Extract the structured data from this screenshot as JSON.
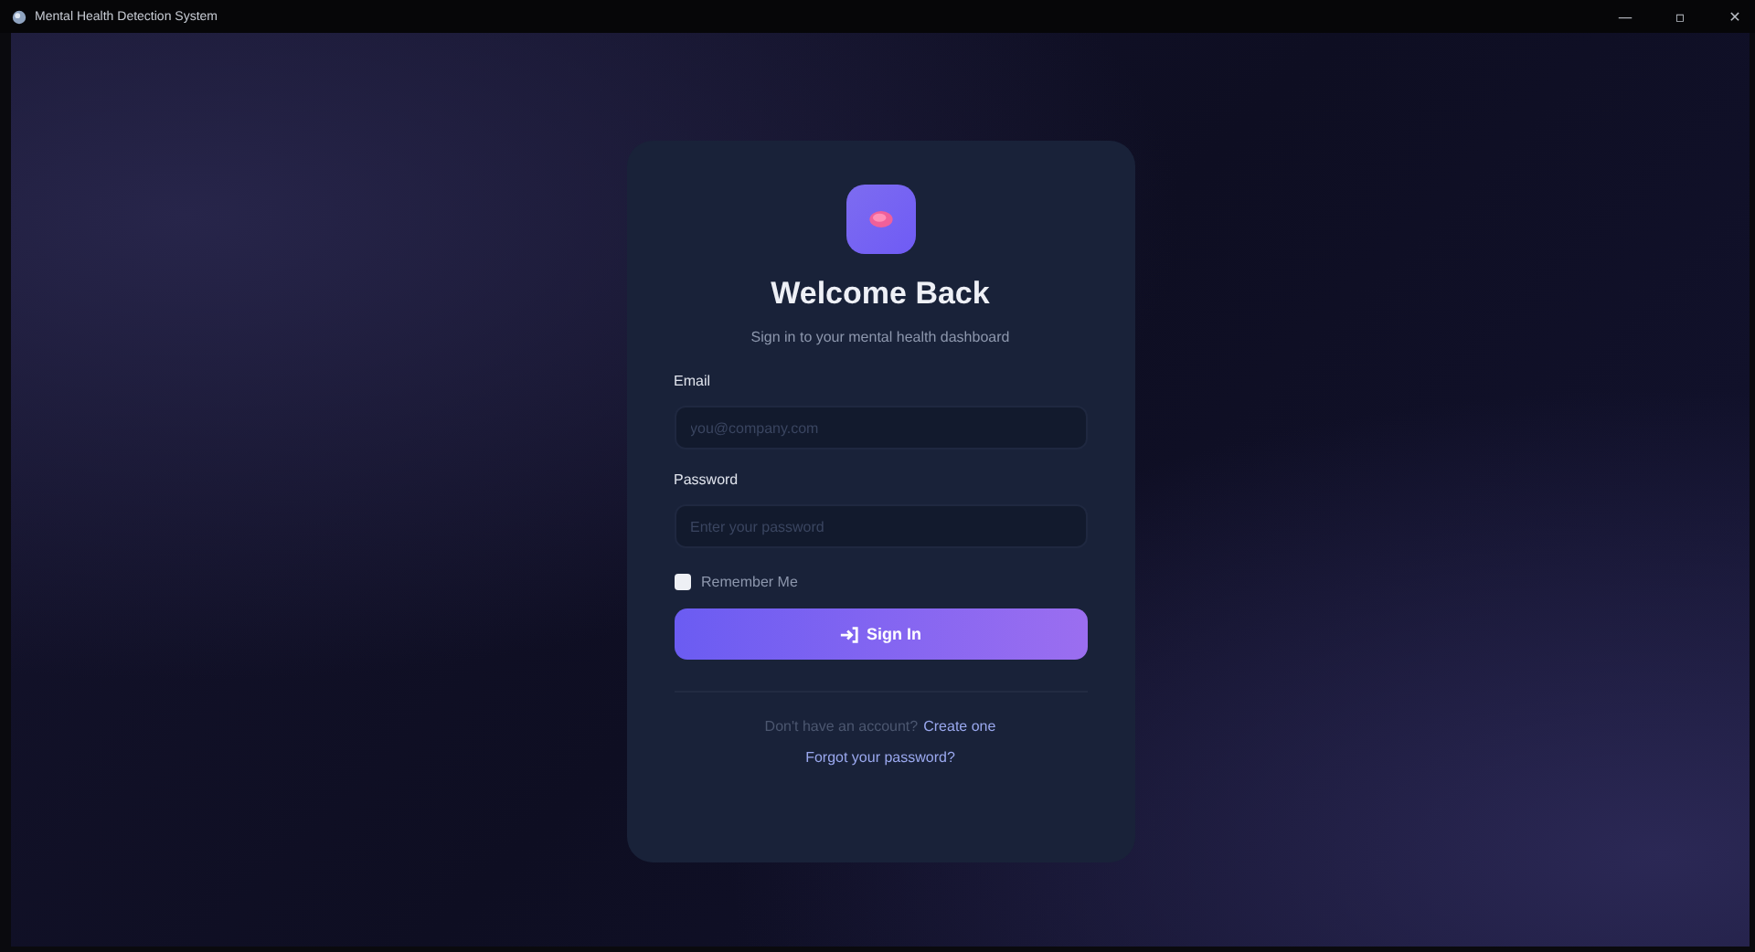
{
  "window": {
    "title": "Mental Health Detection System",
    "controls": [
      "—",
      "▫",
      "✕"
    ]
  },
  "login": {
    "title": "Welcome Back",
    "subtitle": "Sign in to your mental health dashboard",
    "fields": [
      {
        "label": "Email",
        "placeholder": "you@company.com"
      },
      {
        "label": "Password",
        "placeholder": "Enter your password"
      }
    ],
    "remember": {
      "label": "Remember Me",
      "checked": false
    },
    "button": "Sign In",
    "signup": {
      "text": "Don't have an account?",
      "link": "Create one"
    },
    "forgot": "Forgot your password?"
  }
}
